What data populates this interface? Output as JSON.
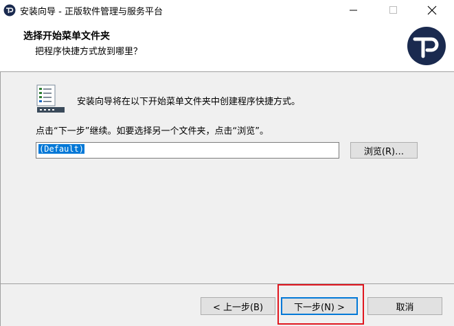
{
  "window": {
    "title": "安装向导 - 正版软件管理与服务平台",
    "controls": {
      "minimize": "—",
      "maximize": "☐",
      "close": "✕"
    }
  },
  "header": {
    "title": "选择开始菜单文件夹",
    "subtitle": "把程序快捷方式放到哪里？"
  },
  "main": {
    "intro": "安装向导将在以下开始菜单文件夹中创建程序快捷方式。",
    "instruction": "点击“下一步”继续。如要选择另一个文件夹，点击“浏览”。",
    "folder_value": "(Default)",
    "browse_label": "浏览(R)…"
  },
  "footer": {
    "back_label": "< 上一步(B)",
    "next_label": "下一步(N) >",
    "cancel_label": "取消"
  },
  "colors": {
    "accent": "#0078d7",
    "highlight": "#e0161e",
    "logo": "#1a2a4f"
  },
  "icons": {
    "app": "gp-logo-icon",
    "logo": "gp-logo",
    "folder_list": "start-menu-list-icon"
  }
}
